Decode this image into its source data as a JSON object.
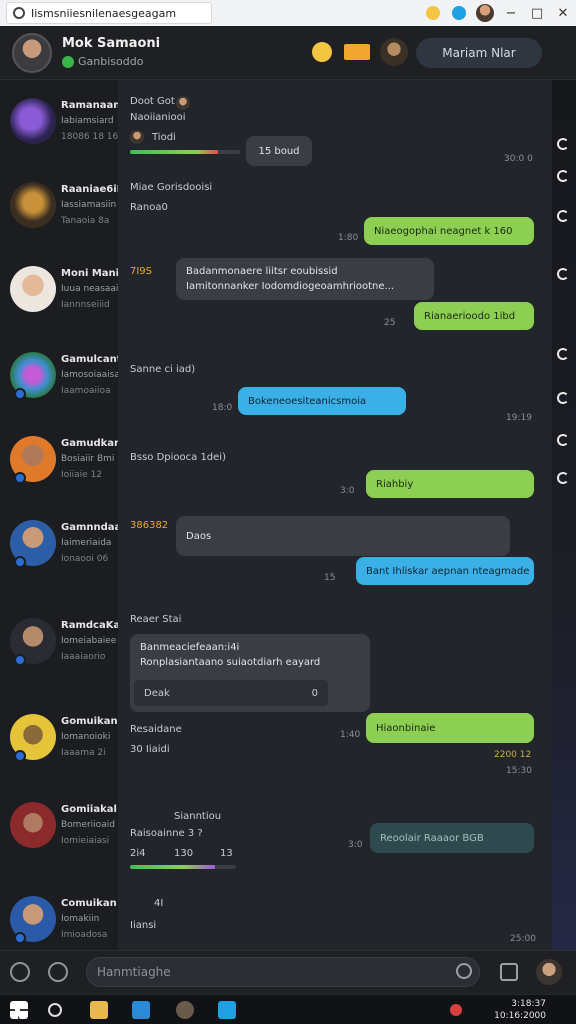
{
  "window": {
    "tab_title": "Iismsniiesnilenaesgeagam",
    "accent": "#3bb0e6"
  },
  "header": {
    "name": "Mok Samaoni",
    "status": "Ganbisoddo",
    "action_button": "Mariam Nlar"
  },
  "sidebar": {
    "items": [
      {
        "name": "Ramanaant",
        "preview": "Iabiamsiard",
        "time": "18086 18 16"
      },
      {
        "name": "Raaniae6iEi",
        "preview": "Iassiamasiin",
        "time": "Tanaoia 8a"
      },
      {
        "name": "Moni Maniu",
        "preview": "Iuua neasaaiu",
        "time": "Iannnseiiid"
      },
      {
        "name": "Gamulcant",
        "preview": "Iamosoiaaisa",
        "time": "Iaamoaiioa"
      },
      {
        "name": "Gamudkar Si",
        "preview": "Bosiaiir Bmi",
        "time": "Ioiiaie 12"
      },
      {
        "name": "Gamnndaant",
        "preview": "Iaimeriaida",
        "time": "Ionaooi 06"
      },
      {
        "name": "RamdcaKar",
        "preview": "Iomeiabaiee",
        "time": "Iaaaiaorio"
      },
      {
        "name": "Gomuikan",
        "preview": "Iomanoioki",
        "time": "Iaaama 2i"
      },
      {
        "name": "Gomiiakal",
        "preview": "Bomeriioaid",
        "time": "Iomieiaiasi"
      },
      {
        "name": "Comuikan",
        "preview": "Iomakiin",
        "time": "Imioadosa"
      }
    ]
  },
  "chat": {
    "m1_sender": "Doot Got",
    "m1_sub": "Naoiianiooi",
    "m1_name": "Tiodi",
    "m1_badge": "15 boud",
    "m1_time": "30:0 0",
    "m2_sender": "Miae Gorisdooisi",
    "m2_pill": "Ranoa0",
    "m2_green": "Niaeogophai neagnet k 160",
    "m2_time": "1:80",
    "m3_sender": "7I9S",
    "m3_gray_1": "Badanmonaere liitsr eoubissid",
    "m3_gray_2": "Iamitonnanker Iodomdiogeoamhriootne...",
    "m3_green": "Rianaerioodo 1ibd",
    "m3_time": "25",
    "m4_sender": "Sanne ci iad)",
    "m4_blue": "Bokeneoesiteanicsmoia",
    "m4_time": "19:19",
    "m4_left_time": "18:0",
    "m5_sender": "Bsso Dpiooca 1dei)",
    "m5_green": "Riahbiy",
    "m5_time": "3:0",
    "m6_sender": "386382",
    "m6_gray": "Daos",
    "m6_blue": "Bant Ihliskar aepnan nteagmade",
    "m6_time": "15",
    "m7_sender": "Reaer Stai",
    "m7_card_1": "Banmeaciefeaan:i4i",
    "m7_card_2": "Ronplasiantaano suiaotdiarh eayard",
    "m7_reply_label": "Deak",
    "m7_reply_count": "0",
    "m8_sender": "Resaidane",
    "m8_pill": "30 Iiaidi",
    "m8_green": "Hiaonbinaie",
    "m8_time": "1:40",
    "m8_meta": "2200 12",
    "m8_meta2": "15:30",
    "m9_sender": "Sianntiou",
    "m9_sub": "Raisoainne 3 ?",
    "m9_a": "2i4",
    "m9_b": "130",
    "m9_c": "13",
    "m9_dark": "Reoolair Raaaor BGB",
    "m9_time": "3:0",
    "m10_sub": "4I",
    "m10_pill": "Iiansi",
    "m10_time": "25:00"
  },
  "composer": {
    "placeholder": "Hanmtiaghe"
  },
  "taskbar": {
    "time": "3:18:37",
    "date": "10:16:2000"
  }
}
